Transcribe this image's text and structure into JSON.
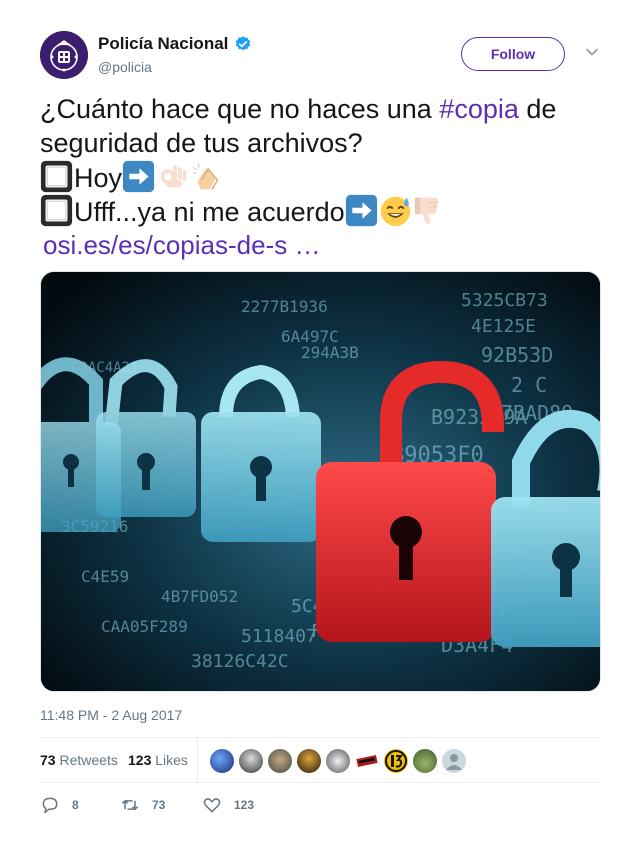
{
  "user": {
    "display_name": "Policía Nacional",
    "handle": "@policia",
    "verified_icon": "verified-badge-icon",
    "avatar_icon": "police-crest-avatar"
  },
  "follow_label": "Follow",
  "tweet": {
    "line1_a": "¿Cuánto hace que no haces una ",
    "hashtag": "#copia",
    "line1_b": " de",
    "line2": "seguridad de tus archivos?",
    "option1": "Hoy",
    "option2": "Ufff...ya ni me acuerdo",
    "link": "osi.es/es/copias-de-s …",
    "emojis": [
      "checkbox-icon",
      "right-arrow-icon",
      "ok-hand-icon",
      "clapping-hands-icon",
      "sweat-smile-icon",
      "thumbs-down-icon"
    ]
  },
  "media_alt_icon": "padlocks-binary-code-image",
  "timestamp": "11:48 PM - 2 Aug 2017",
  "stats": {
    "retweets_count": "73",
    "retweets_label": "Retweets",
    "likes_count": "123",
    "likes_label": "Likes"
  },
  "actions": {
    "replies": "8",
    "retweets": "73",
    "likes": "123"
  },
  "colors": {
    "accent": "#5c2fb5",
    "muted": "#657786",
    "verified": "#1da1f2"
  }
}
